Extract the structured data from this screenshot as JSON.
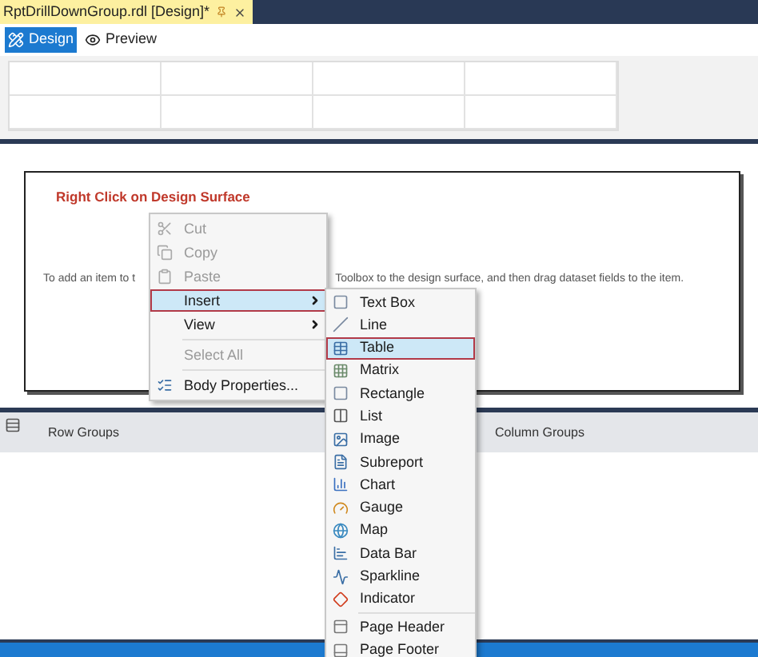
{
  "document_tab": {
    "title": "RptDrillDownGroup.rdl [Design]*"
  },
  "view_tabs": [
    {
      "label": "Design",
      "selected": true
    },
    {
      "label": "Preview",
      "selected": false
    }
  ],
  "design_surface": {
    "annotation": "Right Click on Design Surface",
    "hint_parts": [
      "To add an item to t",
      "Toolbox to the design surface, and then drag dataset fields to the item."
    ]
  },
  "context_menu": {
    "items": [
      {
        "kind": "item",
        "label": "Cut",
        "disabled": true,
        "selected": false,
        "submenu": false
      },
      {
        "kind": "item",
        "label": "Copy",
        "disabled": true,
        "selected": false,
        "submenu": false
      },
      {
        "kind": "item",
        "label": "Paste",
        "disabled": true,
        "selected": false,
        "submenu": false
      },
      {
        "kind": "item",
        "label": "Insert",
        "disabled": false,
        "selected": true,
        "submenu": true
      },
      {
        "kind": "item",
        "label": "View",
        "disabled": false,
        "selected": false,
        "submenu": true
      },
      {
        "kind": "separator"
      },
      {
        "kind": "item",
        "label": "Select All",
        "disabled": true,
        "selected": false,
        "submenu": false
      },
      {
        "kind": "separator"
      },
      {
        "kind": "item",
        "label": "Body Properties...",
        "disabled": false,
        "selected": false,
        "submenu": false
      }
    ]
  },
  "insert_submenu": {
    "items": [
      {
        "kind": "item",
        "label": "Text Box",
        "selected": false
      },
      {
        "kind": "item",
        "label": "Line",
        "selected": false
      },
      {
        "kind": "item",
        "label": "Table",
        "selected": true
      },
      {
        "kind": "item",
        "label": "Matrix",
        "selected": false
      },
      {
        "kind": "item",
        "label": "Rectangle",
        "selected": false
      },
      {
        "kind": "item",
        "label": "List",
        "selected": false
      },
      {
        "kind": "item",
        "label": "Image",
        "selected": false
      },
      {
        "kind": "item",
        "label": "Subreport",
        "selected": false
      },
      {
        "kind": "item",
        "label": "Chart",
        "selected": false
      },
      {
        "kind": "item",
        "label": "Gauge",
        "selected": false
      },
      {
        "kind": "item",
        "label": "Map",
        "selected": false
      },
      {
        "kind": "item",
        "label": "Data Bar",
        "selected": false
      },
      {
        "kind": "item",
        "label": "Sparkline",
        "selected": false
      },
      {
        "kind": "item",
        "label": "Indicator",
        "selected": false
      },
      {
        "kind": "separator"
      },
      {
        "kind": "item",
        "label": "Page Header",
        "selected": false
      },
      {
        "kind": "item",
        "label": "Page Footer",
        "selected": false
      }
    ]
  },
  "grouping_pane": {
    "row_groups": "Row Groups",
    "column_groups": "Column Groups"
  }
}
